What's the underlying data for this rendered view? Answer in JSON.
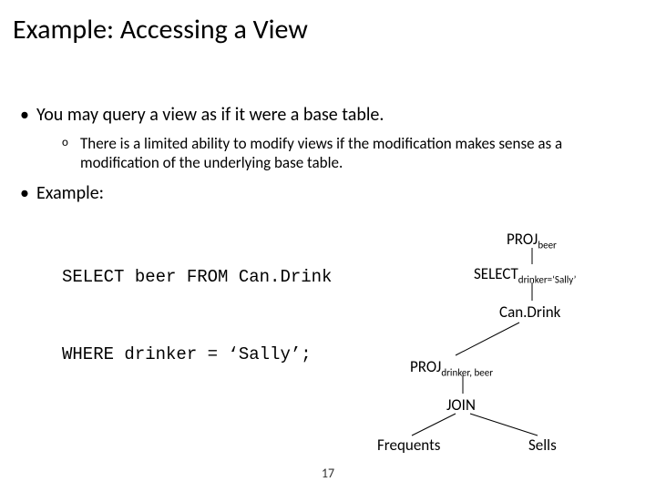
{
  "title": "Example: Accessing a View",
  "bullets": {
    "b1_1": "You may query a view as if it were a base table.",
    "b1_1_sub": "There is a limited ability to modify views if the modification makes sense as a modification of the underlying base table.",
    "b1_2": "Example:"
  },
  "code": {
    "line1": "SELECT beer FROM Can.Drink",
    "line2": "WHERE drinker = ‘Sally’;"
  },
  "tree": {
    "proj_beer_main": "PROJ",
    "proj_beer_sub": "beer",
    "select_main": "SELECT",
    "select_sub": "drinker=‘Sally’",
    "candrink": "Can.Drink",
    "proj_db_main": "PROJ",
    "proj_db_sub": "drinker, beer",
    "join": "JOIN",
    "frequents": "Frequents",
    "sells": "Sells"
  },
  "pagenum": "17"
}
